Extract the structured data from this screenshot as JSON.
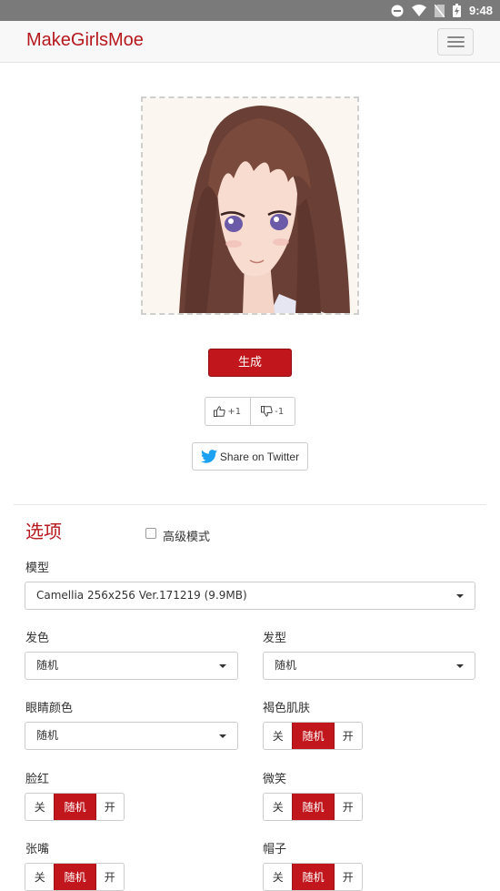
{
  "status_bar": {
    "time": "9:48"
  },
  "navbar": {
    "brand": "MakeGirlsMoe"
  },
  "actions": {
    "generate_label": "生成",
    "upvote_label": "+1",
    "downvote_label": "-1",
    "twitter_label": "Share on Twitter"
  },
  "options": {
    "title": "选项",
    "advanced_mode_label": "高级模式",
    "advanced_mode_checked": false,
    "model": {
      "label": "模型",
      "value": "Camellia 256x256 Ver.171219 (9.9MB)"
    },
    "hair_color": {
      "label": "发色",
      "value": "随机"
    },
    "hair_style": {
      "label": "发型",
      "value": "随机"
    },
    "eye_color": {
      "label": "眼睛颜色",
      "value": "随机"
    },
    "dark_skin": {
      "label": "褐色肌肤",
      "off": "关",
      "random": "随机",
      "on": "开",
      "selected": "random"
    },
    "blush": {
      "label": "脸红",
      "off": "关",
      "random": "随机",
      "on": "开",
      "selected": "random"
    },
    "smile": {
      "label": "微笑",
      "off": "关",
      "random": "随机",
      "on": "开",
      "selected": "random"
    },
    "open_mouth": {
      "label": "张嘴",
      "off": "关",
      "random": "随机",
      "on": "开",
      "selected": "random"
    },
    "hat": {
      "label": "帽子",
      "off": "关",
      "random": "随机",
      "on": "开",
      "selected": "random"
    }
  },
  "colors": {
    "accent": "#c0161c",
    "brand_text": "#b5181d",
    "status_bar": "#7a7a7a",
    "twitter": "#1da1f2"
  },
  "icons": [
    "dnd-icon",
    "wifi-icon",
    "no-sim-icon",
    "battery-icon",
    "hamburger-icon",
    "thumbs-up-icon",
    "thumbs-down-icon",
    "twitter-bird-icon",
    "caret-down-icon"
  ]
}
